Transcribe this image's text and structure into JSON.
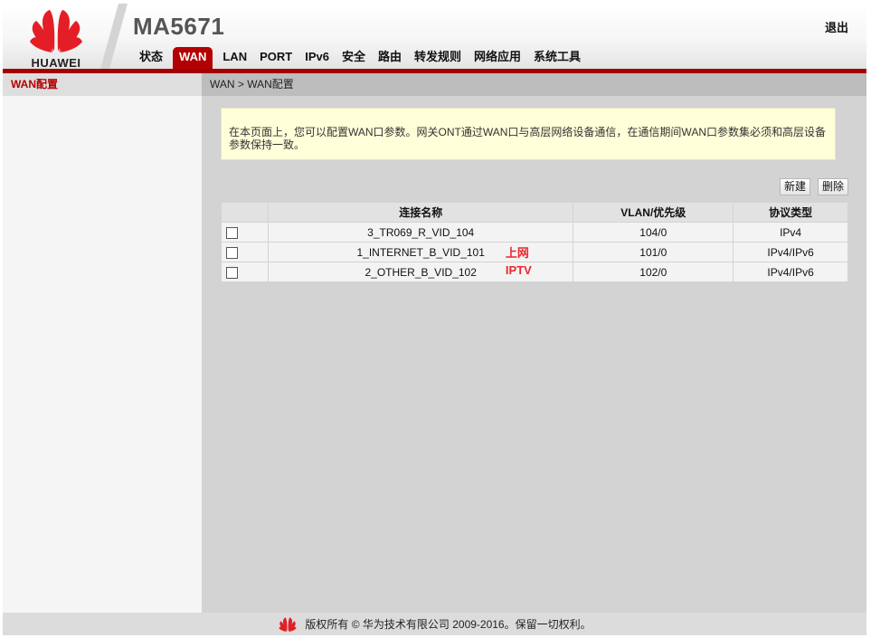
{
  "header": {
    "brand": "HUAWEI",
    "device_title": "MA5671",
    "logout_label": "退出",
    "nav": [
      {
        "label": "状态"
      },
      {
        "label": "WAN",
        "active": true
      },
      {
        "label": "LAN"
      },
      {
        "label": "PORT"
      },
      {
        "label": "IPv6"
      },
      {
        "label": "安全"
      },
      {
        "label": "路由"
      },
      {
        "label": "转发规则"
      },
      {
        "label": "网络应用"
      },
      {
        "label": "系统工具"
      }
    ]
  },
  "sidebar": {
    "items": [
      {
        "label": "WAN配置",
        "active": true
      }
    ]
  },
  "main": {
    "breadcrumb": "WAN > WAN配置",
    "notice": "在本页面上，您可以配置WAN口参数。网关ONT通过WAN口与高层网络设备通信，在通信期间WAN口参数集必须和高层设备参数保持一致。",
    "buttons": {
      "new_label": "新建",
      "delete_label": "删除"
    },
    "table": {
      "headers": [
        "",
        "连接名称",
        "VLAN/优先级",
        "协议类型"
      ],
      "rows": [
        {
          "name": "3_TR069_R_VID_104",
          "vlan": "104/0",
          "protocol": "IPv4",
          "annotation": ""
        },
        {
          "name": "1_INTERNET_B_VID_101",
          "vlan": "101/0",
          "protocol": "IPv4/IPv6",
          "annotation": "上网"
        },
        {
          "name": "2_OTHER_B_VID_102",
          "vlan": "102/0",
          "protocol": "IPv4/IPv6",
          "annotation": "IPTV"
        }
      ]
    }
  },
  "footer": {
    "copyright": "版权所有 © 华为技术有限公司 2009-2016。保留一切权利。"
  },
  "colors": {
    "brand_red": "#a30000",
    "active_tab": "#b30000",
    "annotation": "#e8282e",
    "notice_bg": "#ffffd9"
  }
}
